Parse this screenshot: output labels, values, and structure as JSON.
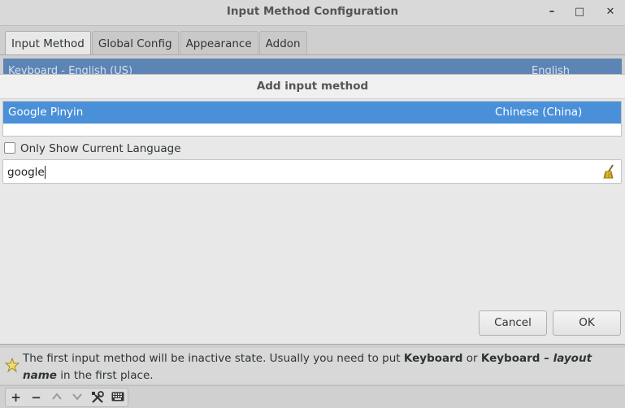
{
  "window": {
    "title": "Input Method Configuration",
    "minimize_glyph": "–",
    "maximize_glyph": "□",
    "close_glyph": "✕"
  },
  "tabs": [
    {
      "label": "Input Method",
      "active": true
    },
    {
      "label": "Global Config",
      "active": false
    },
    {
      "label": "Appearance",
      "active": false
    },
    {
      "label": "Addon",
      "active": false
    }
  ],
  "background_list": {
    "selected_name": "Keyboard - English (US)",
    "selected_lang": "English"
  },
  "dialog": {
    "title": "Add input method",
    "results": [
      {
        "name": "Google Pinyin",
        "language": "Chinese (China)",
        "selected": true
      }
    ],
    "only_current_language": {
      "label": "Only Show Current Language",
      "checked": false
    },
    "search": {
      "value": "google",
      "clear_icon": "broom-icon"
    },
    "cancel_label": "Cancel",
    "ok_label": "OK"
  },
  "hint": {
    "part1": "The first input method will be inactive state. Usually you need to put ",
    "bold1": "Keyboard",
    "part2": " or ",
    "bold2": "Keyboard – ",
    "italic": "layout name",
    "part3": " in the first place."
  },
  "toolbar": {
    "add": "+",
    "remove": "−",
    "up": "^",
    "down": "v"
  },
  "colors": {
    "selection": "#4a90d9",
    "background_selection": "#5c84b5"
  }
}
